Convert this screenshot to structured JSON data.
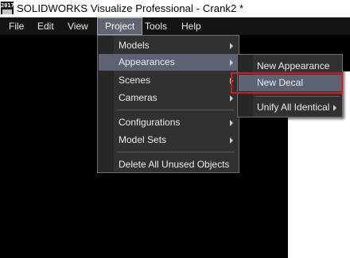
{
  "window": {
    "icon_text": "2017",
    "title": "SOLIDWORKS Visualize Professional - Crank2 *"
  },
  "menubar": {
    "items": [
      "File",
      "Edit",
      "View",
      "Project",
      "Tools",
      "Help"
    ],
    "active": "Project"
  },
  "project_menu": {
    "items": [
      "Models",
      "Appearances",
      "Scenes",
      "Cameras",
      "Configurations",
      "Model Sets",
      "Delete All Unused Objects"
    ],
    "highlighted": "Appearances"
  },
  "appearances_submenu": {
    "items": [
      "New Appearance",
      "New Decal",
      "Unify All Identical"
    ],
    "highlighted": "New Decal",
    "callout_color": "#d21b1b"
  },
  "colors": {
    "menubar_bg": "#141414",
    "menu_bg": "#313131",
    "highlight": "#5d6274"
  },
  "icons": [
    "app-logo-icon",
    "submenu-arrow-icon"
  ]
}
